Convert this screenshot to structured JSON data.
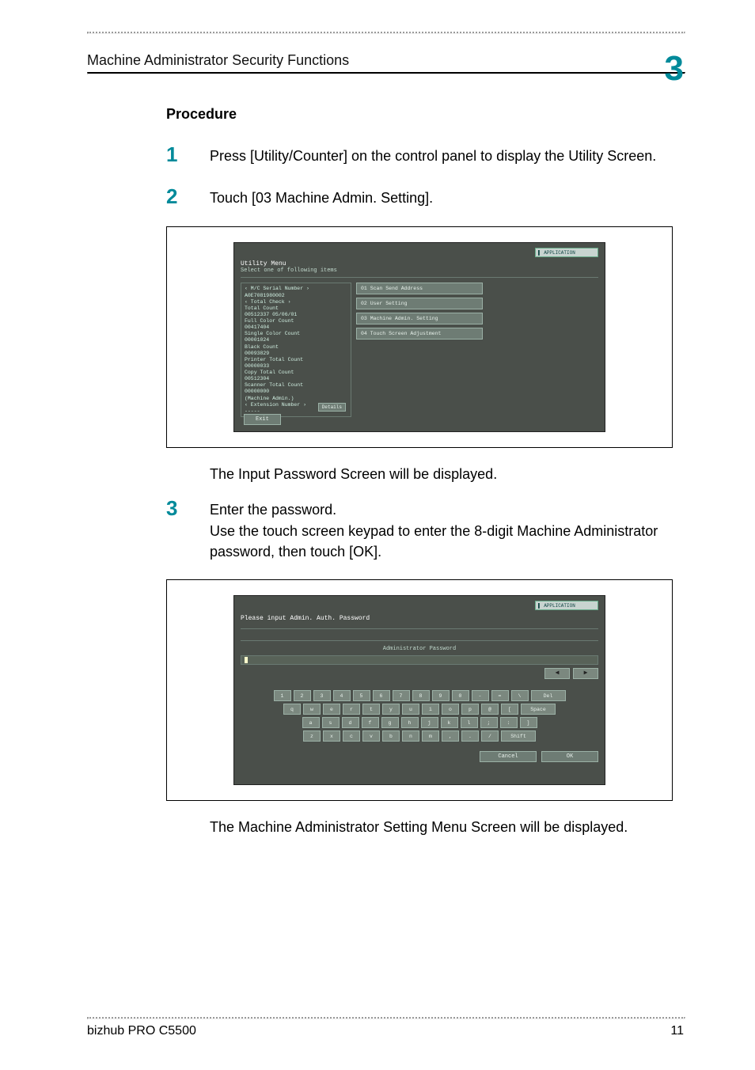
{
  "header": {
    "title": "Machine Administrator Security Functions",
    "chapter_number": "3"
  },
  "section_title": "Procedure",
  "steps": [
    {
      "num": "1",
      "text": "Press [Utility/Counter] on the control panel to display the Utility Screen."
    },
    {
      "num": "2",
      "text": "Touch [03 Machine Admin. Setting]."
    },
    {
      "num": "3",
      "text": "Enter the password.\nUse the touch screen keypad to enter the 8-digit Machine Administrator password, then touch [OK]."
    }
  ],
  "caption_after_s2": "The Input Password Screen will be displayed.",
  "caption_after_s3": "The Machine Administrator Setting Menu Screen will be displayed.",
  "lcd1": {
    "tab": "▌ APPLICATION",
    "title": "Utility Menu",
    "subtitle": "Select one of following items",
    "sidebar_lines": [
      "‹ M/C Serial Number ›",
      "  A0E7081980002",
      "‹ Total Check ›",
      "Total Count",
      "  00512337     05/06/01",
      "Full Color Count",
      "  00417404",
      "Single Color Count",
      "  00001024",
      "Black Count",
      "  00093829",
      "Printer Total Count",
      "  00000033",
      "Copy Total Count",
      "  00512304",
      "Scanner Total Count",
      "  00000000",
      "(Machine Admin.)",
      "",
      "‹ Extension Number ›",
      "  -----"
    ],
    "menu": [
      "01 Scan Send Address",
      "02 User Setting",
      "03 Machine Admin. Setting",
      "04 Touch Screen Adjustment"
    ],
    "details_label": "Details",
    "exit_label": "Exit"
  },
  "lcd2": {
    "tab": "▌ APPLICATION",
    "title": "Please input Admin. Auth. Password",
    "field_label": "Administrator Password",
    "arrow_left": "◀",
    "arrow_right": "▶",
    "row1": [
      "1",
      "2",
      "3",
      "4",
      "5",
      "6",
      "7",
      "8",
      "9",
      "0",
      "-",
      "=",
      "\\",
      "Del"
    ],
    "row2": [
      "q",
      "w",
      "e",
      "r",
      "t",
      "y",
      "u",
      "i",
      "o",
      "p",
      "@",
      "[",
      "Space"
    ],
    "row3": [
      "a",
      "s",
      "d",
      "f",
      "g",
      "h",
      "j",
      "k",
      "l",
      ";",
      ":",
      "]"
    ],
    "row4": [
      "z",
      "x",
      "c",
      "v",
      "b",
      "n",
      "m",
      ",",
      ".",
      "/",
      "Shift"
    ],
    "cancel": "Cancel",
    "ok": "OK"
  },
  "footer": {
    "product": "bizhub PRO C5500",
    "page": "11"
  }
}
